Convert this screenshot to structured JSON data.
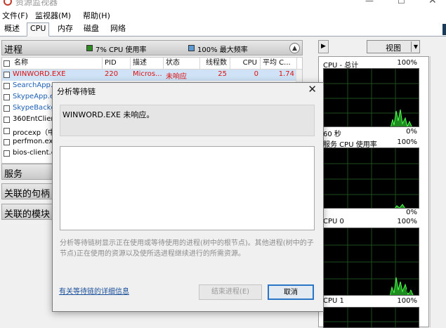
{
  "window": {
    "title": "资源监视器",
    "min": "—",
    "max": "☐",
    "close": "✕"
  },
  "menu": [
    "文件(F)",
    "监视器(M)",
    "帮助(H)"
  ],
  "tabs": [
    "概述",
    "CPU",
    "内存",
    "磁盘",
    "网络"
  ],
  "processes": {
    "title": "进程",
    "cpu_usage": "7% CPU 使用率",
    "max_freq": "100% 最大频率",
    "columns": [
      "名称",
      "PID",
      "描述",
      "状态",
      "线程数",
      "CPU",
      "平均 C..."
    ],
    "rows": [
      {
        "name": "WINWORD.EXE",
        "pid": "220",
        "desc": "Micros...",
        "status": "未响应",
        "threads": "25",
        "cpu": "0",
        "avg": "1.74",
        "color": "#d11"
      },
      {
        "name": "SearchApp.ex",
        "color": "#1a5fb4"
      },
      {
        "name": "SkypeApp.exe",
        "color": "#1a5fb4"
      },
      {
        "name": "SkypeBackgro",
        "color": "#1a5fb4"
      },
      {
        "name": "360EntClient.e",
        "color": "#000000"
      },
      {
        "name": "procexp（中文",
        "color": "#000000"
      },
      {
        "name": "perfmon.exe",
        "color": "#000000"
      },
      {
        "name": "bios-client.ex",
        "color": "#000000"
      }
    ]
  },
  "sections": [
    "服务",
    "关联的句柄",
    "关联的模块"
  ],
  "graphs": {
    "view_label": "视图",
    "items": [
      {
        "title": "CPU - 总计",
        "top_value": "100%",
        "time": "60 秒",
        "bottom_value": "0%"
      },
      {
        "title": "服务 CPU 使用率",
        "top_value": "100%",
        "bottom_value": "0%"
      },
      {
        "title": "CPU 0",
        "top_value": "100%",
        "bottom_value": "0%"
      },
      {
        "title": "CPU 1",
        "top_value": "100%"
      }
    ]
  },
  "dialog": {
    "title": "分析等待链",
    "message": "WINWORD.EXE 未响应。",
    "description": "分析等待链树显示正在使用或等待使用的进程(树中的根节点)。其他进程(树中的子节点)正在使用的资源以及使所选进程继续进行的所需资源。",
    "link": "有关等待链的详细信息",
    "end_button": "结束进程(E)",
    "cancel_button": "取消"
  },
  "colors": {
    "cpu_legend": "#2e8b22",
    "freq_legend": "#5b9bd5",
    "graph_fill": "#1e8c1e",
    "graph_line": "#4cff4c"
  }
}
